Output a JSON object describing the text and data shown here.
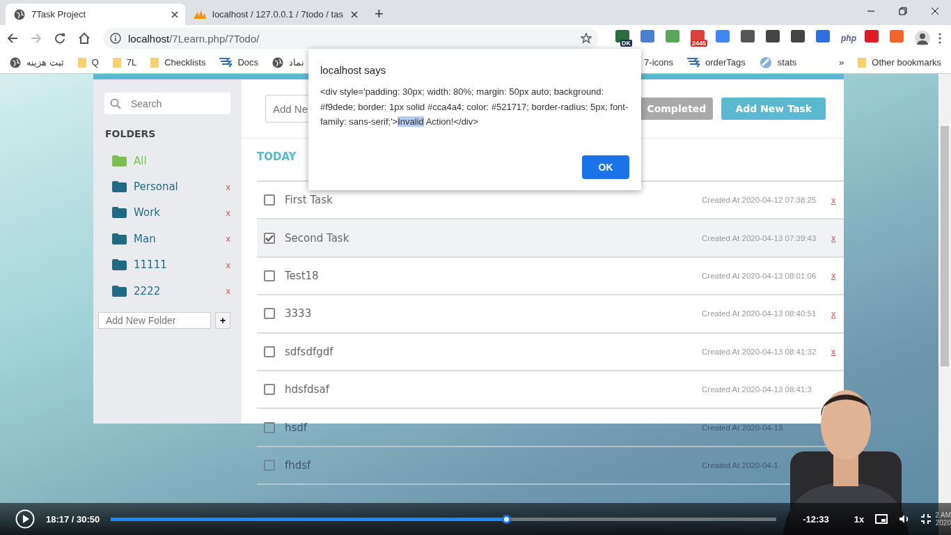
{
  "browser": {
    "tabs": [
      {
        "title": "7Task Project",
        "selected": true,
        "kind": "globe"
      },
      {
        "title": "localhost / 127.0.0.1 / 7todo / tas",
        "selected": false,
        "kind": "pma"
      }
    ],
    "new_tab": "+",
    "address": {
      "host": "localhost",
      "path": "/7Learn.php/7Todo/"
    },
    "extensions": [
      {
        "kind": "globe",
        "badge": "DK",
        "color": "#2a6e3f"
      },
      {
        "kind": "pin",
        "color": "#4a7fd4"
      },
      {
        "kind": "sheet",
        "color": "#58a55c"
      },
      {
        "kind": "mail",
        "badge": "2445",
        "color": "#e0403a"
      },
      {
        "kind": "translate",
        "color": "#4285f4"
      },
      {
        "kind": "bulb",
        "color": "#555555"
      },
      {
        "kind": "ring",
        "color": "#444444"
      },
      {
        "kind": "pen",
        "color": "#444444"
      },
      {
        "kind": "folder",
        "color": "#2f6fe0"
      },
      {
        "kind": "text",
        "badge": "php",
        "color": "#4f5b93"
      },
      {
        "kind": "stop",
        "color": "#e01b24"
      },
      {
        "kind": "tower",
        "color": "#f0642c"
      }
    ],
    "bookmarks": [
      {
        "label": "ثبت هزینه",
        "kind": "globe"
      },
      {
        "label": "Q",
        "kind": "folder"
      },
      {
        "label": "7L",
        "kind": "folder"
      },
      {
        "label": "Checklists",
        "kind": "folder"
      },
      {
        "label": "Docs",
        "kind": "docs"
      },
      {
        "label": "نماد",
        "kind": "globe"
      }
    ],
    "bookmarks_right": [
      {
        "label": "7-icons",
        "kind": "plain"
      },
      {
        "label": "orderTags",
        "kind": "docs"
      },
      {
        "label": "stats",
        "kind": "stats"
      }
    ],
    "more_bookmarks": "»",
    "other_bookmarks": "Other bookmarks"
  },
  "sidebar": {
    "search": {
      "placeholder": "Search"
    },
    "heading": "FOLDERS",
    "folders": [
      {
        "name": "All",
        "selected": true
      },
      {
        "name": "Personal",
        "selected": false,
        "delete": "x"
      },
      {
        "name": "Work",
        "selected": false,
        "delete": "x"
      },
      {
        "name": "Man",
        "selected": false,
        "delete": "x"
      },
      {
        "name": "11111",
        "selected": false,
        "delete": "x"
      },
      {
        "name": "2222",
        "selected": false,
        "delete": "x"
      }
    ],
    "new_folder": {
      "placeholder": "Add New Folder"
    },
    "add_button": "+"
  },
  "toolbar": {
    "task_field": {
      "placeholder": "Add Ne"
    },
    "completed_button": "Completed",
    "add_button": "Add New Task"
  },
  "section": "TODAY",
  "tasks": [
    {
      "title": "First Task",
      "checked": false,
      "created": "Created At 2020-04-12 07:38:25",
      "delete": "x"
    },
    {
      "title": "Second Task",
      "checked": true,
      "created": "Created At 2020-04-13 07:39:43",
      "delete": "x"
    },
    {
      "title": "Test18",
      "checked": false,
      "created": "Created At 2020-04-13 08:01:06",
      "delete": "x"
    },
    {
      "title": "3333",
      "checked": false,
      "created": "Created At 2020-04-13 08:40:51",
      "delete": "x"
    },
    {
      "title": "sdfsdfgdf",
      "checked": false,
      "created": "Created At 2020-04-13 08:41:32",
      "delete": "x"
    },
    {
      "title": "hdsfdsaf",
      "checked": false,
      "created": "Created At 2020-04-13 08:41:3"
    },
    {
      "title": "hsdf",
      "checked": false,
      "created": "Created At 2020-04-13",
      "faded": true
    },
    {
      "title": "fhdsf",
      "checked": false,
      "created": "Created At 2020-04-1",
      "faded": true
    }
  ],
  "dialog": {
    "title": "localhost says",
    "before": "<div style='padding: 30px; width: 80%; margin: 50px auto; background: #f9dede; border: 1px solid #cca4a4; color: #521717; border-radius: 5px; font-family: sans-serif;'>",
    "highlighted": "Invalid",
    "after": " Action!</div>",
    "ok": "OK"
  },
  "player": {
    "time": "18:17 / 30:50",
    "progress": {
      "level": 0.594
    },
    "remaining": "-12:33",
    "speed": "1x"
  },
  "taskbar_clock": [
    "2 AM",
    "2020"
  ]
}
